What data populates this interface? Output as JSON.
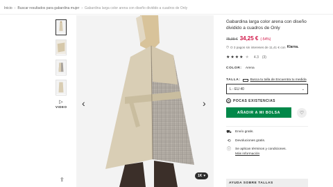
{
  "breadcrumb": {
    "items": [
      "Inicio",
      "Buscar resultados para gabardina mujer",
      "Gabardina larga color arena con diseño dividido a cuadros de Only"
    ]
  },
  "gallery": {
    "video_label": "VIDEO",
    "saves_count": "1K"
  },
  "product": {
    "title": "Gabardina larga color arena con diseño dividido a cuadros de Only",
    "old_price": "75,99 €",
    "price": "34,25 €",
    "discount": "(-54%)",
    "klarna_text": "O 3 pagos sin intereses de 11,41 € con",
    "klarna_brand": "Klarna.",
    "rating_value": "4.3",
    "rating_count": "(3)",
    "stars": "★★★★",
    "star_half": "★",
    "color_label": "COLOR:",
    "color_value": "Arena",
    "size_label": "TALLA:",
    "size_link": "Busca tu talla de Encuentra tu medida",
    "size_selected": "L - EU 40",
    "stock": "POCAS EXISTENCIAS",
    "add_to_bag": "AÑADIR A MI BOLSA"
  },
  "shipping": {
    "lines": [
      {
        "icon": "truck-icon",
        "text": "Envío gratis."
      },
      {
        "icon": "return-icon",
        "text": "Devoluciones gratis."
      },
      {
        "icon": "info-icon",
        "text": "Se aplican términos y condiciones.",
        "link": "Más información"
      }
    ]
  },
  "help": "AYUDA SOBRE TALLAS"
}
